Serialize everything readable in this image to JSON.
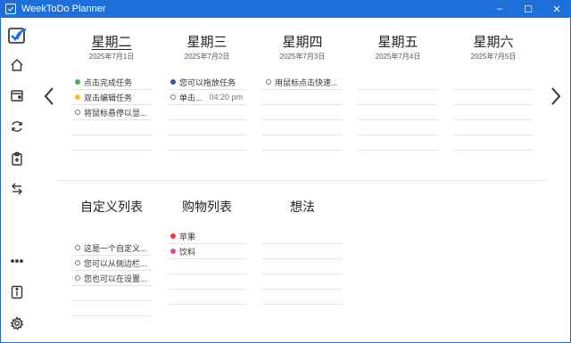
{
  "window": {
    "title": "WeekToDo Planner",
    "controls": {
      "minimize": "–",
      "maximize": "☐",
      "close": "✕"
    }
  },
  "sidebar": {
    "items": [
      "logo-icon",
      "home-icon",
      "calendar-icon",
      "refresh-icon",
      "clipboard-icon",
      "swap-icon",
      "more-icon",
      "info-icon",
      "settings-icon"
    ]
  },
  "colors": {
    "titlebar": "#1e6fd9",
    "green": "#4caf50",
    "yellow": "#f2c12e",
    "blue": "#3f51b5",
    "red": "#e53935",
    "pink": "#d64aa0"
  },
  "days": [
    {
      "name": "星期二",
      "date": "2025年7月1日",
      "today": true,
      "tasks": [
        {
          "text": "点击完成任务",
          "marker": "green"
        },
        {
          "text": "双击编辑任务",
          "marker": "yellow"
        },
        {
          "text": "将鼠标悬停以显...",
          "marker": "ring"
        }
      ]
    },
    {
      "name": "星期三",
      "date": "2025年7月2日",
      "today": false,
      "tasks": [
        {
          "text": "您可以拖放任务",
          "marker": "blue"
        },
        {
          "text": "单击...",
          "marker": "ring",
          "time": "04:20 pm"
        }
      ]
    },
    {
      "name": "星期四",
      "date": "2025年7月3日",
      "today": false,
      "tasks": [
        {
          "text": "用鼠标点击快速...",
          "marker": "ring"
        }
      ]
    },
    {
      "name": "星期五",
      "date": "2025年7月4日",
      "today": false,
      "tasks": []
    },
    {
      "name": "星期六",
      "date": "2025年7月5日",
      "today": false,
      "tasks": []
    }
  ],
  "lists": [
    {
      "name": "自定义列表",
      "tasks": [
        {
          "text": "这是一个自定义...",
          "marker": "ring"
        },
        {
          "text": "您可以从侧边栏...",
          "marker": "ring"
        },
        {
          "text": "您也可以在设置...",
          "marker": "ring"
        }
      ]
    },
    {
      "name": "购物列表",
      "tasks": [
        {
          "text": "苹果",
          "marker": "red"
        },
        {
          "text": "饮料",
          "marker": "pink"
        }
      ]
    },
    {
      "name": "想法",
      "tasks": []
    }
  ]
}
